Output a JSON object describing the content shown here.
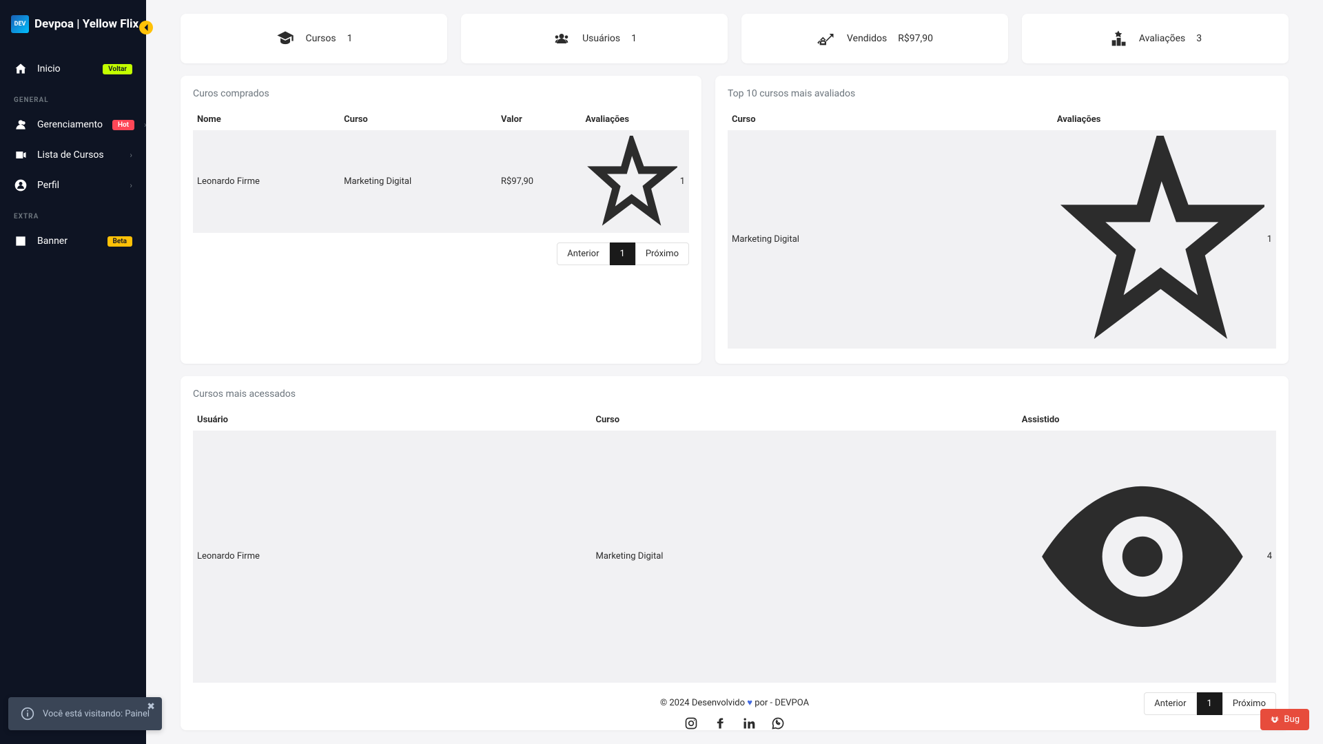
{
  "brand": "Devpoa | Yellow Flix",
  "sidebar": {
    "inicio": {
      "label": "Inicio",
      "badge": "Voltar"
    },
    "sections": {
      "general": "GENERAL",
      "extra": "EXTRA"
    },
    "gerenciamento": {
      "label": "Gerenciamento",
      "badge": "Hot"
    },
    "lista_cursos": {
      "label": "Lista de Cursos"
    },
    "perfil": {
      "label": "Perfil"
    },
    "banner": {
      "label": "Banner",
      "badge": "Beta"
    }
  },
  "stats": {
    "cursos": {
      "label": "Cursos",
      "value": "1"
    },
    "usuarios": {
      "label": "Usuários",
      "value": "1"
    },
    "vendidos": {
      "label": "Vendidos",
      "value": "R$97,90"
    },
    "avaliacoes": {
      "label": "Avaliações",
      "value": "3"
    }
  },
  "comprados": {
    "title": "Curos comprados",
    "headers": {
      "nome": "Nome",
      "curso": "Curso",
      "valor": "Valor",
      "avaliacoes": "Avaliações"
    },
    "row": {
      "nome": "Leonardo Firme",
      "curso": "Marketing Digital",
      "valor": "R$97,90",
      "rating": "1"
    },
    "pagination": {
      "prev": "Anterior",
      "page": "1",
      "next": "Próximo"
    }
  },
  "top_avaliados": {
    "title": "Top 10 cursos mais avaliados",
    "headers": {
      "curso": "Curso",
      "avaliacoes": "Avaliações"
    },
    "row": {
      "curso": "Marketing Digital",
      "rating": "1"
    }
  },
  "mais_acessados": {
    "title": "Cursos mais acessados",
    "headers": {
      "usuario": "Usuário",
      "curso": "Curso",
      "assistido": "Assistido"
    },
    "row": {
      "usuario": "Leonardo Firme",
      "curso": "Marketing Digital",
      "views": "4"
    },
    "pagination": {
      "prev": "Anterior",
      "page": "1",
      "next": "Próximo"
    }
  },
  "footer": {
    "text_before": "© 2024 Desenvolvido ",
    "text_after": " por - DEVPOA"
  },
  "toast": {
    "message": "Você está visitando: Painel"
  },
  "bug": {
    "label": "Bug"
  }
}
